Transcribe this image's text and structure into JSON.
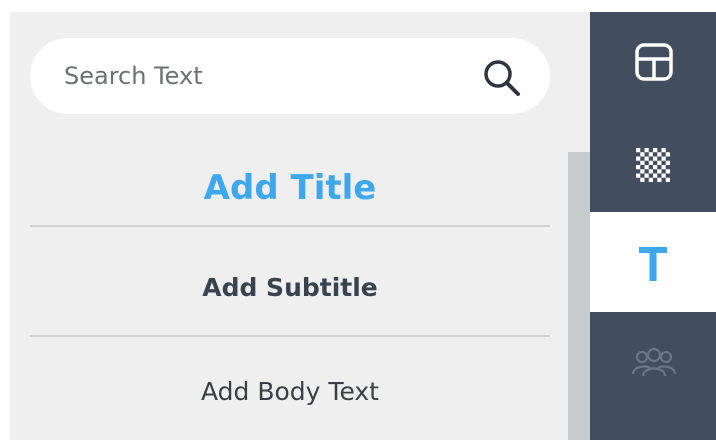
{
  "search": {
    "placeholder": "Search Text",
    "value": "",
    "icon": "search-icon"
  },
  "text_options": [
    {
      "label": "Add Title",
      "color": "#3fa7ee"
    },
    {
      "label": "Add Subtitle",
      "color": "#394350"
    },
    {
      "label": "Add Body Text",
      "color": "#3b3f45"
    }
  ],
  "toolbar": {
    "background_color": "#424e5d",
    "active_color": "#3fa7ee",
    "items": [
      {
        "icon": "layout-icon",
        "active": false
      },
      {
        "icon": "checkerboard-background-icon",
        "active": false
      },
      {
        "icon": "text-icon",
        "active": true
      },
      {
        "icon": "people-icon",
        "active": false
      }
    ]
  }
}
